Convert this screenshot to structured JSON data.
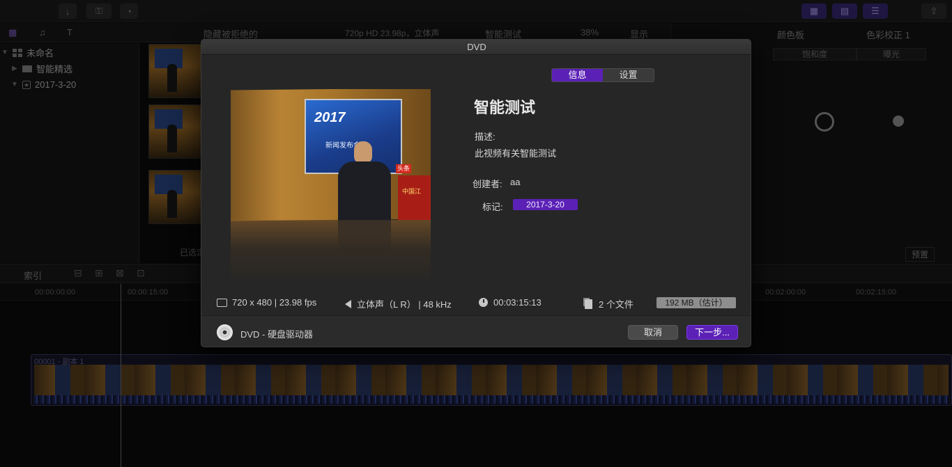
{
  "browser": {
    "filter_label": "隐藏被拒绝的",
    "format_label": "720p HD 23.98p，立体声",
    "project_name": "智能测试",
    "zoom": "38%",
    "view_label": "显示",
    "selection_label": "已选定"
  },
  "sidebar": {
    "library": "未命名",
    "items": [
      {
        "label": "智能精选"
      },
      {
        "label": "2017-3-20"
      }
    ]
  },
  "inspector": {
    "title": "颜色板",
    "effect": "色彩校正 1",
    "tabs": [
      "饱和度",
      "曝光"
    ],
    "preset_label": "预置"
  },
  "timeline": {
    "index_label": "索引",
    "timecodes": [
      "00:00:00:00",
      "00:00:15:00",
      "00:02:00:00",
      "00:02:15:00"
    ],
    "clip_label": "00001 - 副本 1"
  },
  "dialog": {
    "title": "DVD",
    "tabs": [
      {
        "label": "信息",
        "active": true
      },
      {
        "label": "设置",
        "active": false
      }
    ],
    "poster": {
      "screen_year": "2017",
      "screen_text": "新闻发布会",
      "flag_text": "头条",
      "podium_text": "中国江"
    },
    "disc_title": "智能测试",
    "description_label": "描述:",
    "description_value": "此视频有关智能测试",
    "creator_label": "创建者:",
    "creator_value": "aa",
    "tags_label": "标记:",
    "tag_value": "2017-3-20",
    "stats": {
      "resolution": "720 x 480 | 23.98 fps",
      "audio": "立体声（L R） | 48 kHz",
      "duration": "00:03:15:13",
      "files": "2 个文件",
      "size": "192 MB（估计）"
    },
    "destination": "DVD - 硬盘驱动器",
    "cancel_label": "取消",
    "next_label": "下一步..."
  },
  "colors": {
    "accent": "#5b21b6",
    "dialog_bg": "#262626",
    "app_bg": "#0b0b0b"
  }
}
